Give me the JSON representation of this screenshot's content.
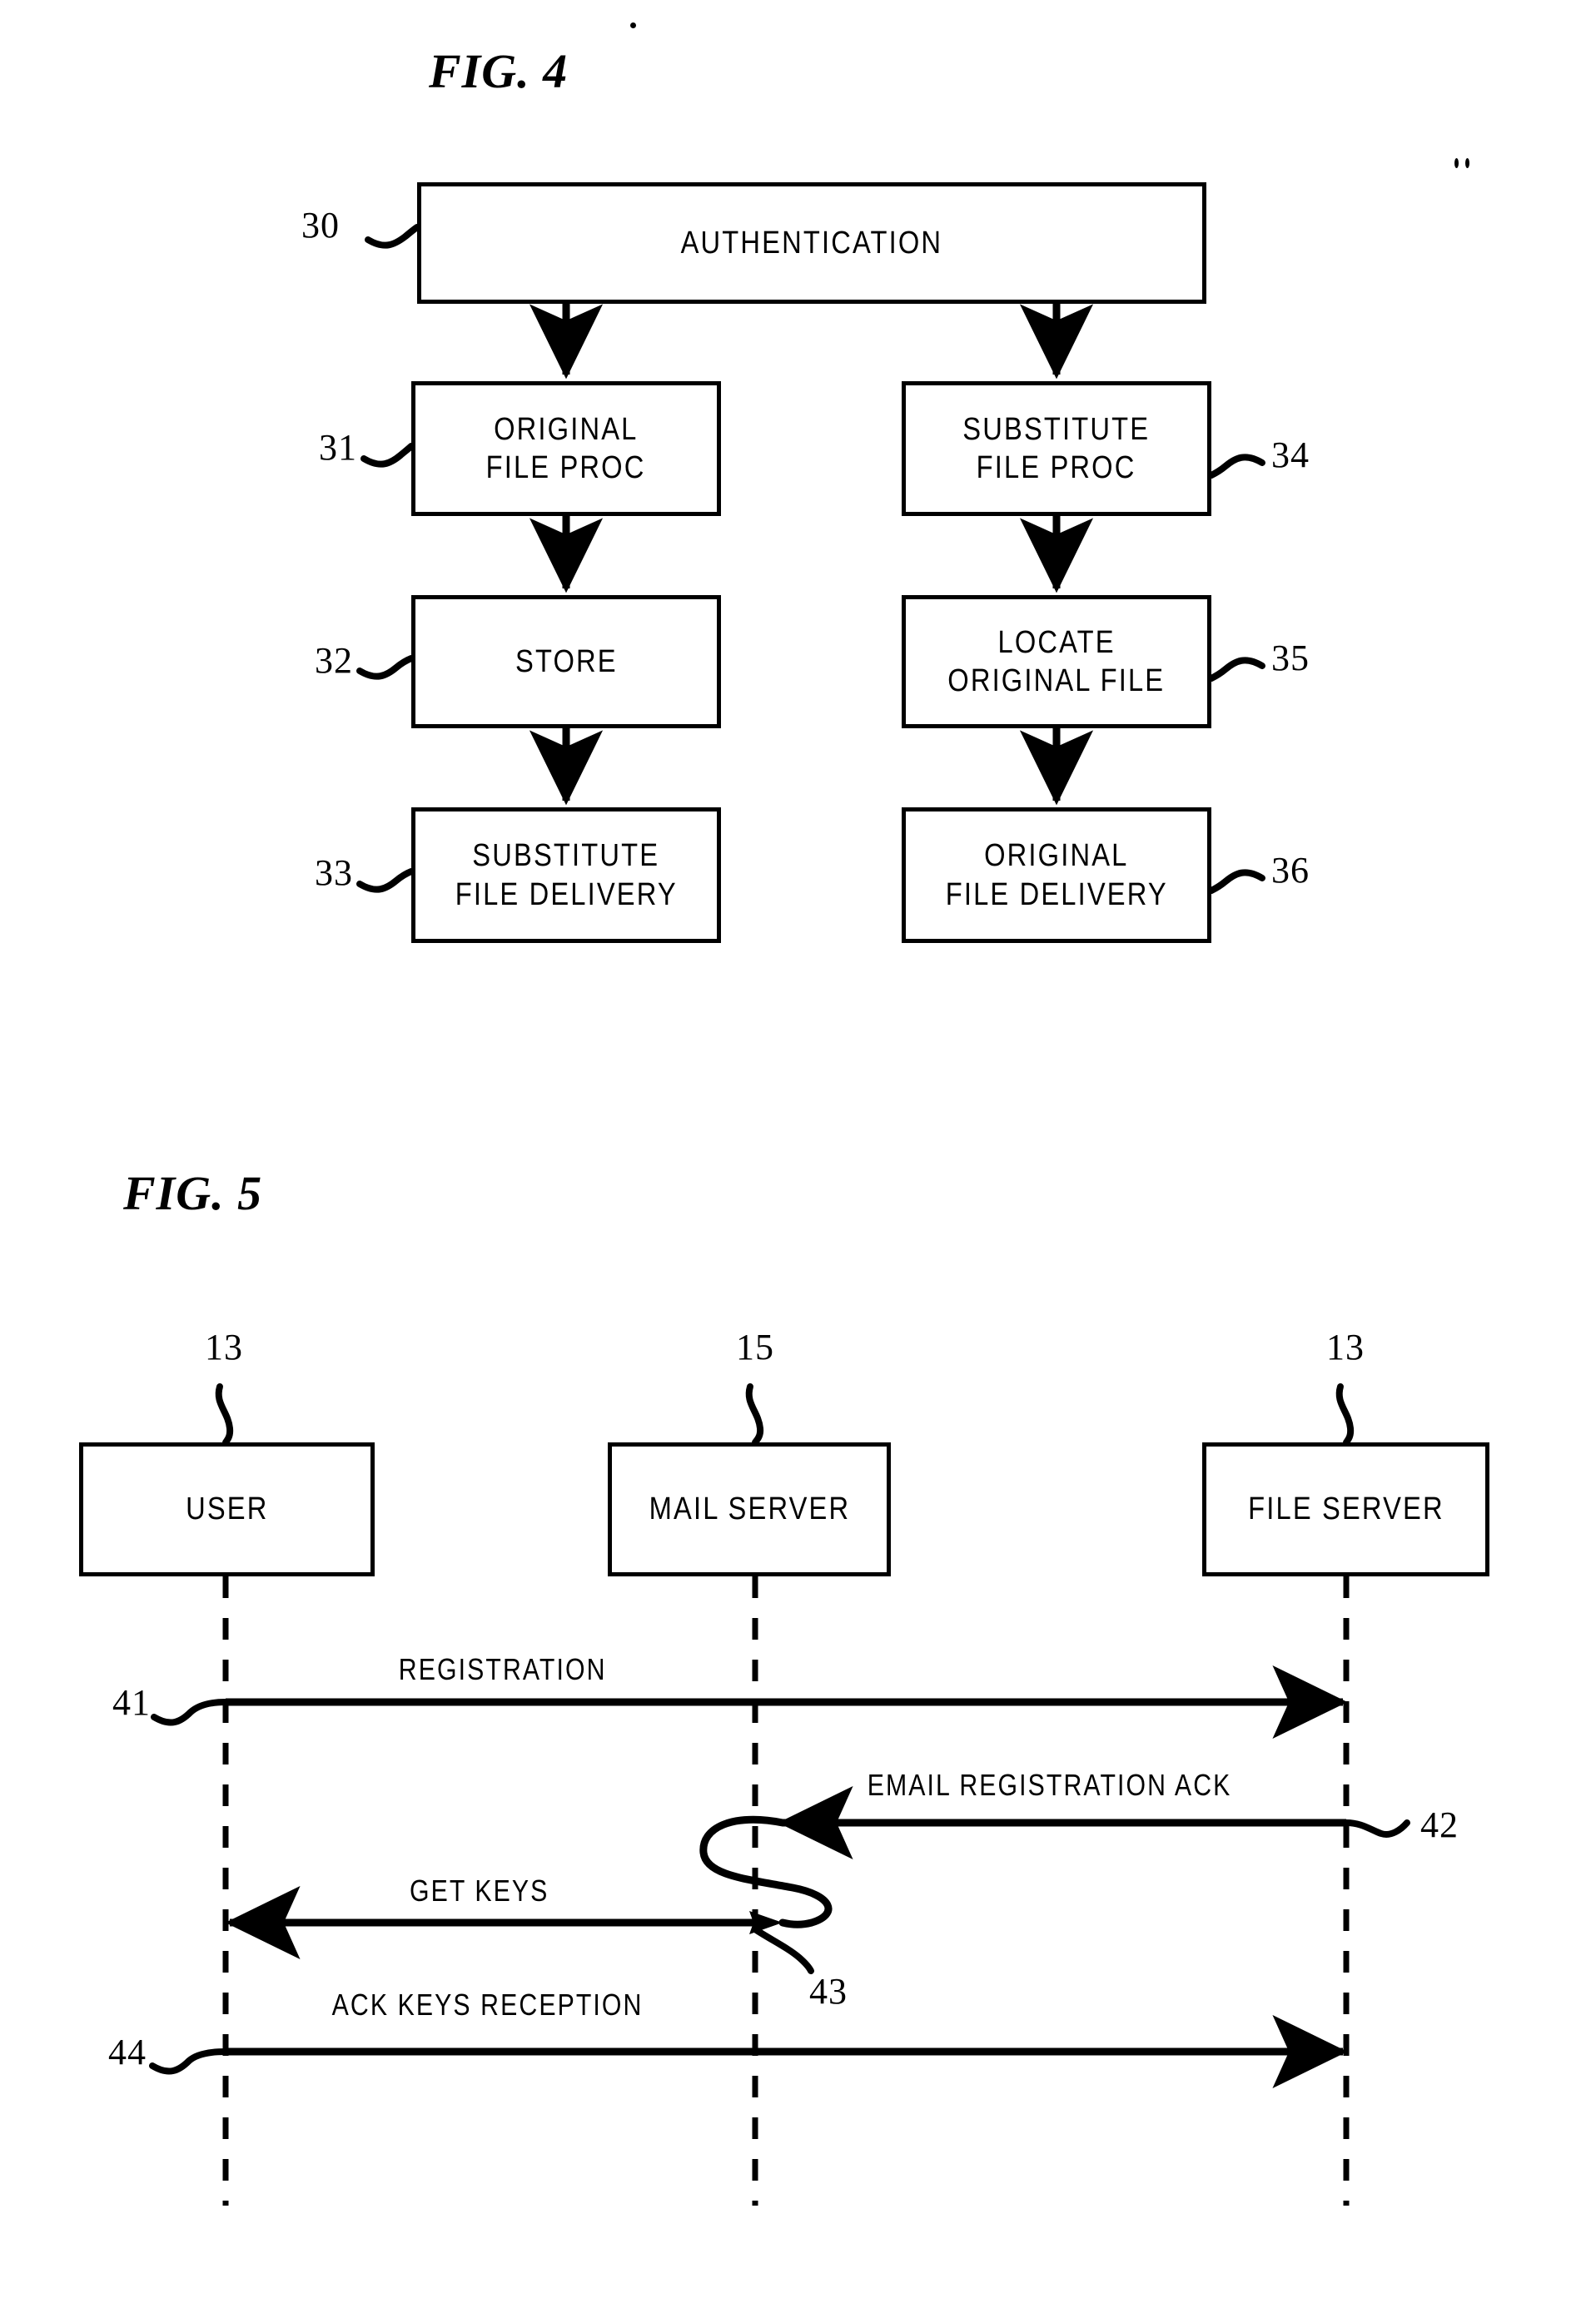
{
  "figures": [
    {
      "title": "FIG. 4",
      "type": "flowchart",
      "nodes": [
        {
          "ref": "30",
          "label_line1": "AUTHENTICATION",
          "label_line2": ""
        },
        {
          "ref": "31",
          "label_line1": "ORIGINAL",
          "label_line2": "FILE PROC"
        },
        {
          "ref": "32",
          "label_line1": "STORE",
          "label_line2": ""
        },
        {
          "ref": "33",
          "label_line1": "SUBSTITUTE",
          "label_line2": "FILE DELIVERY"
        },
        {
          "ref": "34",
          "label_line1": "SUBSTITUTE",
          "label_line2": "FILE PROC"
        },
        {
          "ref": "35",
          "label_line1": "LOCATE",
          "label_line2": "ORIGINAL FILE"
        },
        {
          "ref": "36",
          "label_line1": "ORIGINAL",
          "label_line2": "FILE DELIVERY"
        }
      ]
    },
    {
      "title": "FIG. 5",
      "type": "sequence",
      "lifelines": [
        {
          "ref": "13",
          "label": "USER"
        },
        {
          "ref": "15",
          "label": "MAIL SERVER"
        },
        {
          "ref": "13",
          "label": "FILE SERVER"
        }
      ],
      "messages": [
        {
          "ref": "41",
          "label": "REGISTRATION"
        },
        {
          "ref": "42",
          "label": "EMAIL REGISTRATION ACK"
        },
        {
          "ref": "43",
          "label": "GET KEYS"
        },
        {
          "ref": "44",
          "label": "ACK KEYS RECEPTION"
        }
      ]
    }
  ],
  "colors": {
    "ink": "#000000",
    "paper": "#ffffff"
  }
}
